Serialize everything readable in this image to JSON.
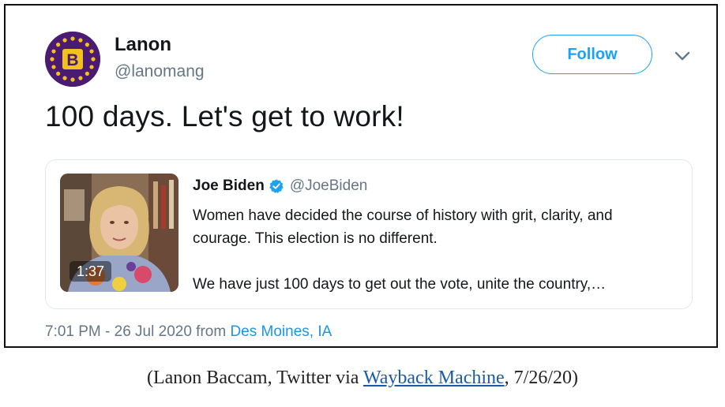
{
  "tweet": {
    "author": {
      "name": "Lanon",
      "handle": "@lanomang",
      "avatar_icon": "purple-seal-letter-b-logo",
      "avatar_letter": "B"
    },
    "follow_label": "Follow",
    "menu_icon": "chevron-down-icon",
    "text": "100 days. Let's get to work!",
    "quoted_tweet": {
      "author_name": "Joe Biden",
      "verified_icon": "verified-badge-icon",
      "author_handle": "@JoeBiden",
      "video_duration": "1:37",
      "text_paragraph_1": "Women have decided the course of history with grit, clarity, and courage. This election is no different.",
      "text_paragraph_2": "We have just 100 days to get out the vote, unite the country,…"
    },
    "timestamp": "7:01 PM - 26 Jul 2020 from",
    "location": "Des Moines, IA"
  },
  "caption": {
    "prefix": "(Lanon Baccam, Twitter via ",
    "link_text": "Wayback Machine",
    "suffix": ", 7/26/20)"
  },
  "colors": {
    "twitter_blue": "#1da1f2",
    "link_blue": "#1b95e0",
    "muted_gray": "#657786",
    "avatar_purple": "#4b1a73",
    "avatar_gold": "#f2c21b"
  }
}
